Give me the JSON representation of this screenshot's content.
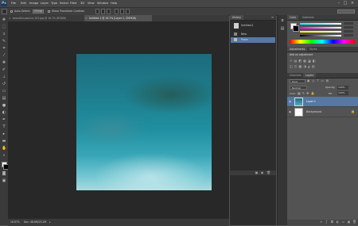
{
  "app": {
    "logo": "Ps"
  },
  "menu": [
    "File",
    "Edit",
    "Image",
    "Layer",
    "Type",
    "Select",
    "Filter",
    "3D",
    "View",
    "Window",
    "Help"
  ],
  "options": {
    "auto_select_label": "Auto-Select:",
    "auto_select_value": "Group",
    "show_transform_label": "Show Transform Controls"
  },
  "tabs": [
    {
      "label": "beautiful-pool-lui-103.jpg @ 16.7% (RGB/8)",
      "active": false
    },
    {
      "label": "Untitled-1 @ 16.7% (Layer 1, CMYK/8)",
      "active": true
    }
  ],
  "status": {
    "zoom": "16.67%",
    "doc": "Doc: 48.6M/25.2M"
  },
  "history": {
    "tab": "History",
    "snapshot": "Untitled-1",
    "items": [
      {
        "label": "New",
        "selected": false
      },
      {
        "label": "Paste",
        "selected": true
      }
    ]
  },
  "color_panel": {
    "tabs": [
      "Color",
      "Swatches"
    ]
  },
  "adjustments_panel": {
    "tabs": [
      "Adjustments",
      "Styles"
    ],
    "hint": "Add an adjustment"
  },
  "layers_panel": {
    "tabs": [
      "Channels",
      "Layers"
    ],
    "kind": "Kind",
    "blend": "Normal",
    "opacity_label": "Opacity:",
    "opacity": "100%",
    "lock_label": "Lock:",
    "fill_label": "Fill:",
    "fill": "100%",
    "layers": [
      {
        "name": "Layer 1",
        "selected": true
      },
      {
        "name": "Background",
        "selected": false
      }
    ]
  },
  "colors": {
    "selection": "#5678a3",
    "workspace": "#282828",
    "panel": "#535353"
  }
}
